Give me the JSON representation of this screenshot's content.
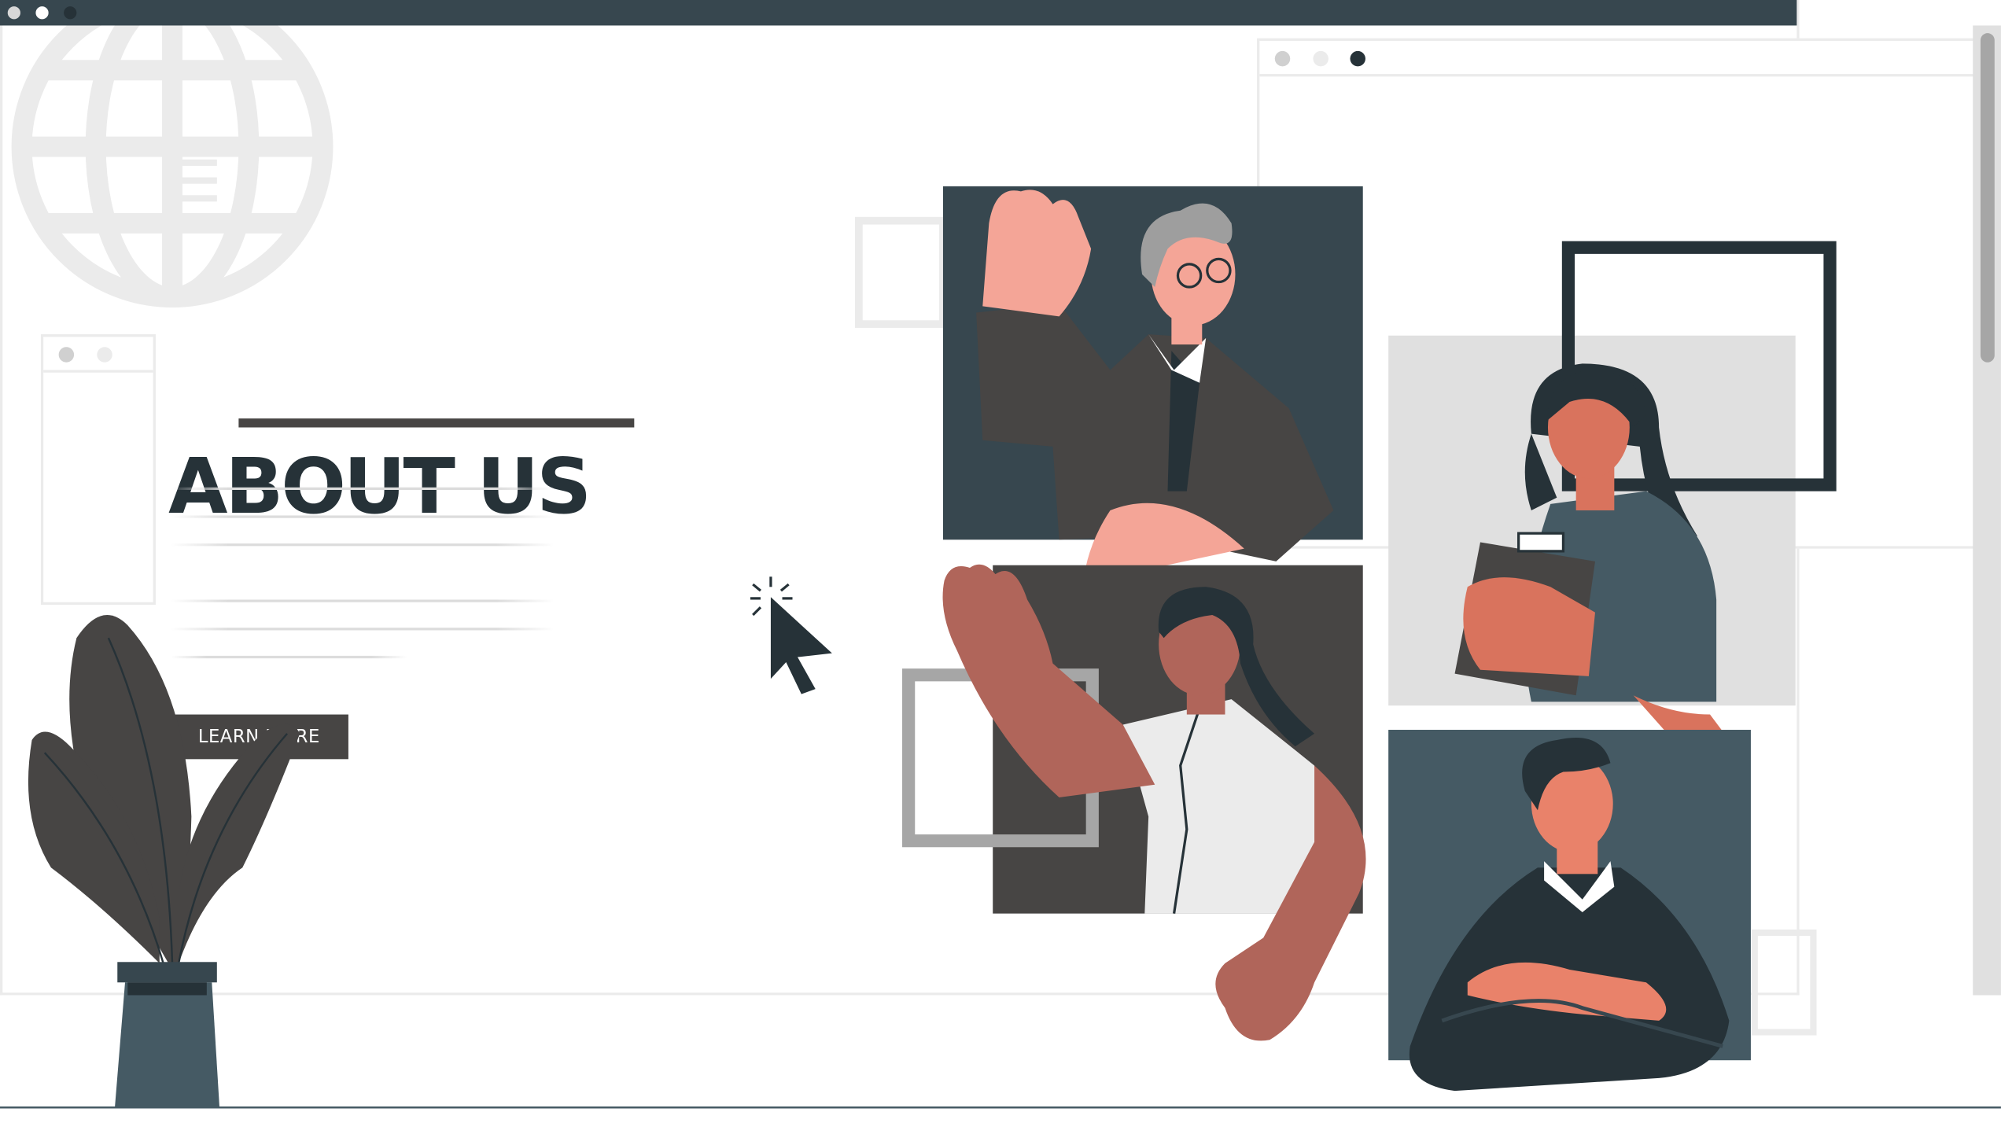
{
  "main": {
    "heading": "ABOUT US",
    "button_label": "LEARN MORE"
  },
  "colors": {
    "titlebar": "#37474f",
    "dark": "#263238",
    "button": "#474544",
    "slate": "#455a64",
    "light_grey": "#ebebeb"
  },
  "icons": [
    "globe-icon",
    "hamburger-menu-icon",
    "mouse-cursor-icon",
    "plant-icon"
  ]
}
